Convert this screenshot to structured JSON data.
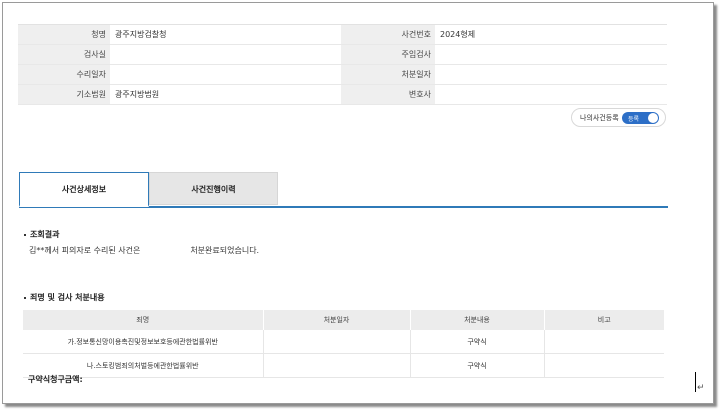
{
  "info": {
    "rows": [
      {
        "l1": "청명",
        "v1": "광주지방검찰청",
        "l2": "사건번호",
        "v2": "2024형제"
      },
      {
        "l1": "검사실",
        "v1": "",
        "l2": "주임검사",
        "v2": ""
      },
      {
        "l1": "수리일자",
        "v1": "",
        "l2": "처분일자",
        "v2": ""
      },
      {
        "l1": "기소법원",
        "v1": "광주지방법원",
        "l2": "변호사",
        "v2": ""
      }
    ]
  },
  "toggle": {
    "label": "나의사건등록",
    "state_text": "등록",
    "on": true,
    "color": "#2d6fc7"
  },
  "tabs": [
    {
      "label": "사건상세정보",
      "active": true
    },
    {
      "label": "사건진행이력",
      "active": false
    }
  ],
  "result": {
    "title": "조회결과",
    "message_part1": "김**께서 피의자로 수리된 사건은",
    "message_part2": "처분완료되었습니다."
  },
  "disposition": {
    "title": "죄명 및 검사 처분내용",
    "headers": [
      "죄명",
      "처분일자",
      "처분내용",
      "비고"
    ],
    "rows": [
      [
        "가.정보통신망이용촉진및정보보호등에관한법률위반",
        "",
        "구약식",
        ""
      ],
      [
        "나.스토킹범죄의처벌등에관한법률위반",
        "",
        "구약식",
        ""
      ]
    ]
  },
  "footer": {
    "amount_label": "구약식청구금액:"
  },
  "return_mark": "↵"
}
